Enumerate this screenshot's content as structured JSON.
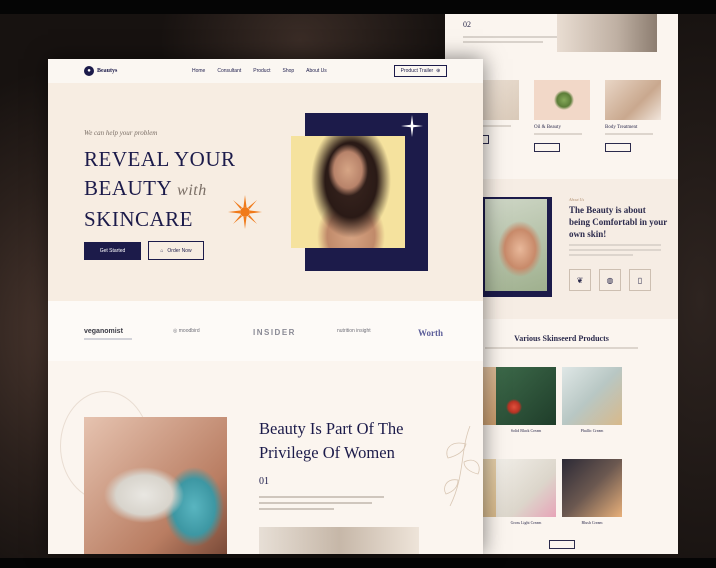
{
  "nav": {
    "logo_text": "Beautys",
    "links": [
      "Home",
      "Consultant",
      "Product",
      "Shop",
      "About Us"
    ],
    "cta_label": "Product Trailer"
  },
  "hero": {
    "kicker": "We can help your problem",
    "title_line1": "REVEAL YOUR",
    "title_line2": "BEAUTY",
    "title_with": "with",
    "title_line3": "SKINCARE",
    "primary_button": "Get Started",
    "secondary_button": "Order Now"
  },
  "brands": [
    "veganomist",
    "moodbird",
    "INSIDER",
    "nutrition insight",
    "Worth"
  ],
  "section2": {
    "title_line1": "Beauty Is Part Of The",
    "title_line2": "Privilege Of Women",
    "number": "01"
  },
  "right_page": {
    "number": "02",
    "services": [
      {
        "title": ""
      },
      {
        "title": "Oil & Beauty"
      },
      {
        "title": "Body Treatment"
      }
    ],
    "about_kicker": "About Us",
    "about_title": "The Beauty is about being Comfortabl in your own skin!",
    "products_title": "Various Skinseerd Products",
    "products": [
      {
        "name": "Solid Black Cream",
        "price": ""
      },
      {
        "name": "Phallic Cream",
        "price": ""
      },
      {
        "name": "Gross Light Cream",
        "price": ""
      },
      {
        "name": "Blush Cream",
        "price": ""
      }
    ]
  },
  "colors": {
    "navy": "#1c1b4a",
    "cream": "#f7ede2",
    "accent_orange": "#f07a1a"
  }
}
